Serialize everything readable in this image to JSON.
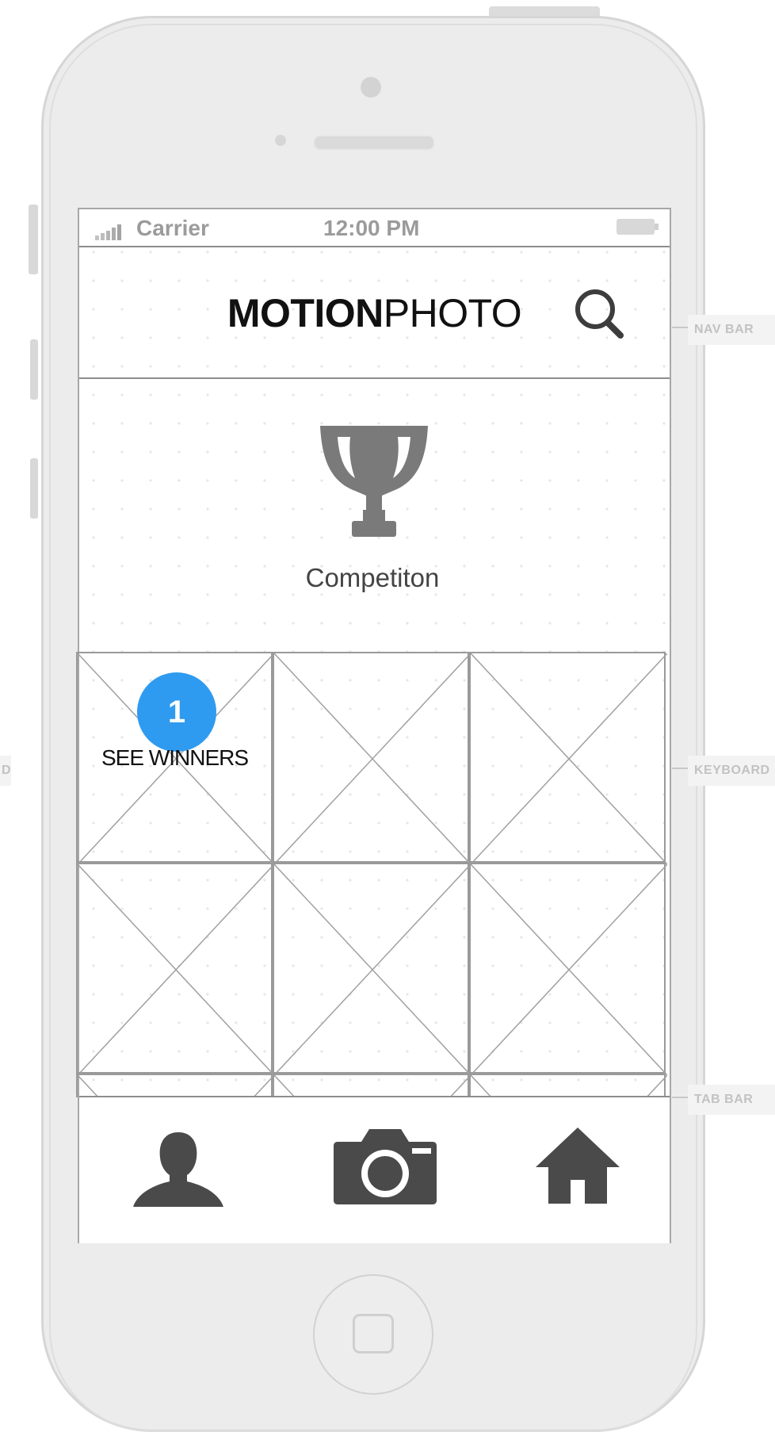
{
  "status_bar": {
    "carrier": "Carrier",
    "time": "12:00 PM"
  },
  "nav_bar": {
    "title_bold": "MOTION",
    "title_regular": "PHOTO"
  },
  "competition": {
    "label": "Competiton"
  },
  "grid": {
    "badge_number": "1",
    "first_cell_label": "SEE WINNERS"
  },
  "annotations": {
    "nav": "NAV BAR",
    "keyboard": "KEYBOARD",
    "tab": "TAB BAR",
    "left": "D"
  },
  "icons": {
    "search": "search-icon",
    "trophy": "trophy-icon",
    "profile": "person-icon",
    "camera": "camera-icon",
    "home": "home-icon"
  },
  "colors": {
    "badge": "#2f9bf0",
    "icon": "#444444"
  }
}
